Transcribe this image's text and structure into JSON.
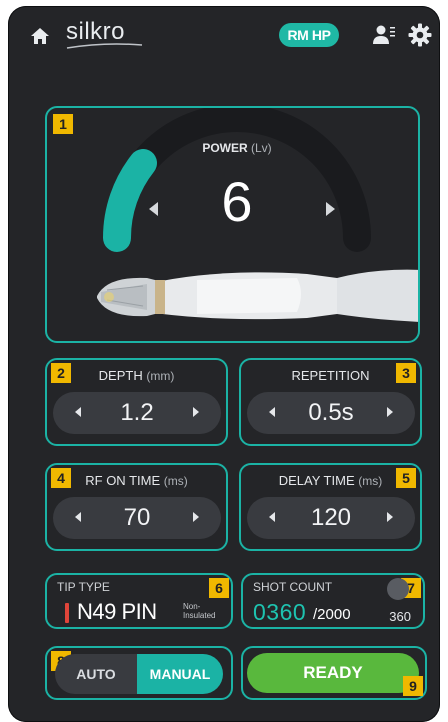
{
  "header": {
    "logo_text": "silkro",
    "mode_badge": "RM HP",
    "icons": [
      "home-icon",
      "user-menu-icon",
      "gear-icon"
    ]
  },
  "power": {
    "number": "1",
    "label": "POWER",
    "unit": "(Lv)",
    "value": "6"
  },
  "depth": {
    "number": "2",
    "label": "DEPTH",
    "unit": "(mm)",
    "value": "1.2"
  },
  "repetition": {
    "number": "3",
    "label": "REPETITION",
    "unit": "",
    "value": "0.5s"
  },
  "rf_on_time": {
    "number": "4",
    "label": "RF ON TIME",
    "unit": "(ms)",
    "value": "70"
  },
  "delay_time": {
    "number": "5",
    "label": "DELAY TIME",
    "unit": "(ms)",
    "value": "120"
  },
  "tip_type": {
    "number": "6",
    "title": "TIP TYPE",
    "name": "N49 PIN",
    "subtitle_line1": "Non-",
    "subtitle_line2": "Insulated"
  },
  "shot_count": {
    "number": "7",
    "title": "SHOT COUNT",
    "count": "0360",
    "max": "/2000",
    "remaining": "360"
  },
  "mode": {
    "number": "8",
    "auto_label": "AUTO",
    "manual_label": "MANUAL"
  },
  "ready": {
    "number": "9",
    "label": "READY"
  },
  "colors": {
    "accent": "#1bb3a5",
    "ready": "#59b83d",
    "badge": "#f0b800",
    "background": "#242528"
  }
}
